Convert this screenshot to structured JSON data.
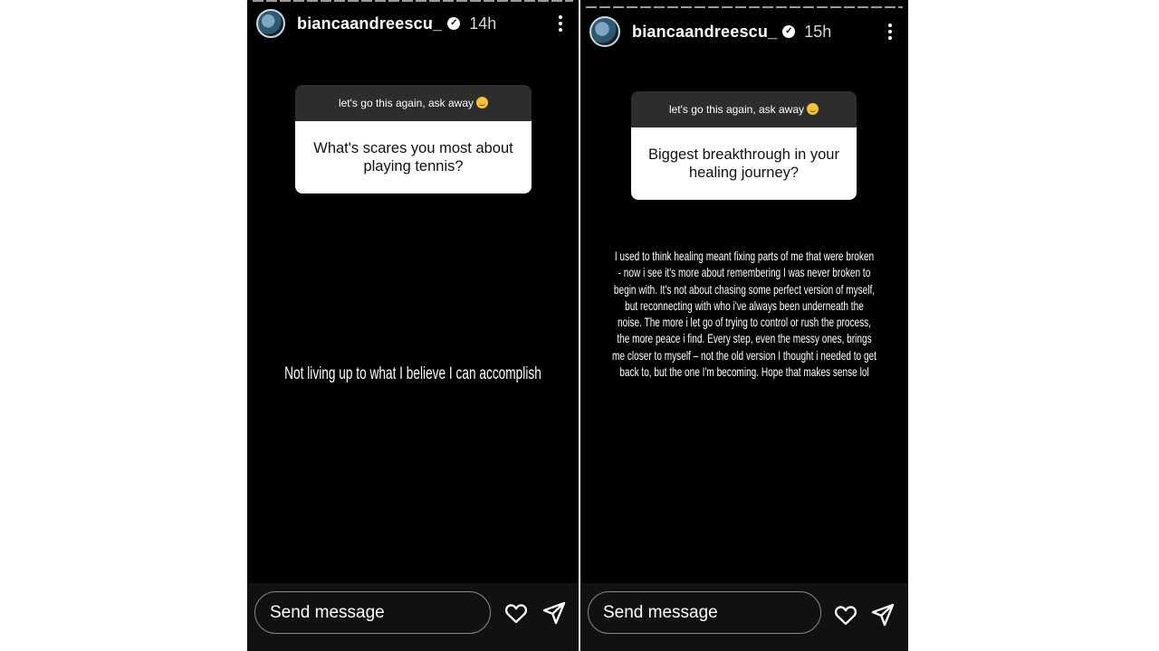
{
  "stories": [
    {
      "username": "biancaandreescu_",
      "time": "14h",
      "question_header": "let's go this again, ask away",
      "question": "What's scares you most about playing tennis?",
      "answer": "Not living up to what I believe I can accomplish",
      "send_placeholder": "Send message"
    },
    {
      "username": "biancaandreescu_",
      "time": "15h",
      "question_header": "let's go this again, ask away",
      "question": "Biggest breakthrough in your healing journey?",
      "answer": "I used to think healing meant fixing parts of me that were broken - now i see it's more about remembering I was never broken to begin with. It's not about chasing some perfect version of myself, but reconnecting with who i've always been underneath the noise. The more i let go of trying to control or rush the process, the more peace i find. Every step, even the messy ones, brings me closer to myself – not the old version I thought i needed to get back to, but the one I'm becoming. Hope that makes sense lol",
      "send_placeholder": "Send message"
    }
  ],
  "icons": {
    "verified": "verified-badge-icon",
    "more": "more-options-icon",
    "emoji": "smiling-face-emoji-icon",
    "heart": "heart-icon",
    "share": "paper-plane-icon"
  },
  "colors": {
    "story_background": "#000000",
    "page_background": "#ffffff",
    "question_header_bg": "#2d2d2d",
    "question_body_bg": "#ffffff"
  }
}
